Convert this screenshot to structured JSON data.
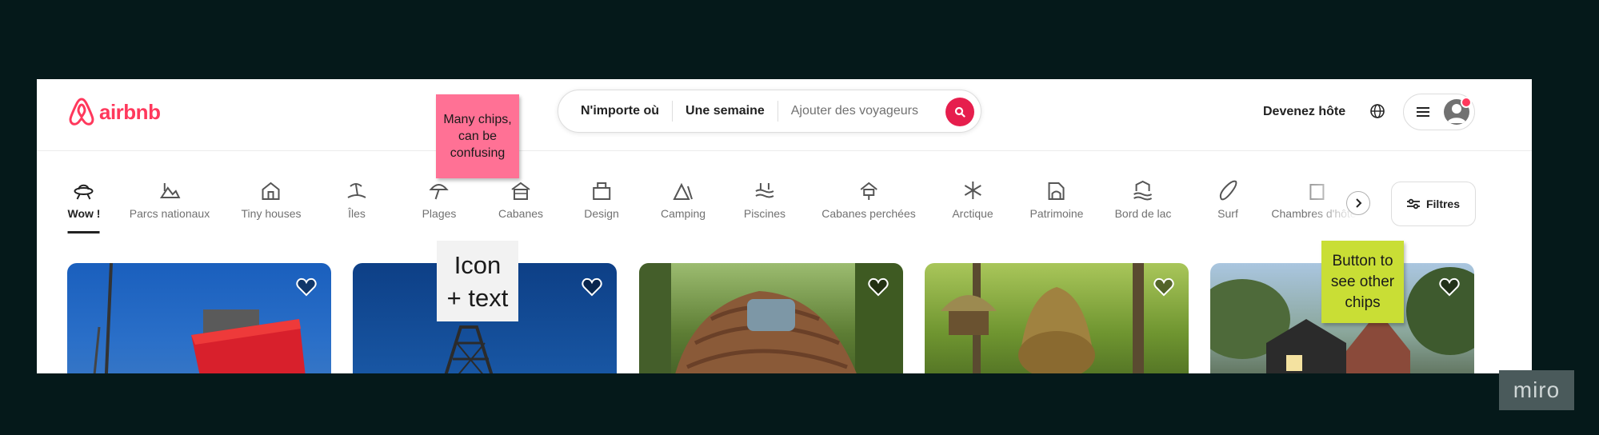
{
  "header": {
    "logo_text": "airbnb",
    "search": {
      "where": "N'importe où",
      "when": "Une semaine",
      "who_placeholder": "Ajouter des voyageurs"
    },
    "host_link": "Devenez hôte"
  },
  "categories": [
    {
      "label": "Wow !",
      "icon": "ufo-icon",
      "active": true
    },
    {
      "label": "Parcs nationaux",
      "icon": "park-icon"
    },
    {
      "label": "Tiny houses",
      "icon": "tiny-house-icon"
    },
    {
      "label": "Îles",
      "icon": "island-icon"
    },
    {
      "label": "Plages",
      "icon": "beach-umbrella-icon"
    },
    {
      "label": "Cabanes",
      "icon": "cabin-icon"
    },
    {
      "label": "Design",
      "icon": "design-icon"
    },
    {
      "label": "Camping",
      "icon": "camping-icon"
    },
    {
      "label": "Piscines",
      "icon": "pool-icon"
    },
    {
      "label": "Cabanes perchées",
      "icon": "treehouse-icon"
    },
    {
      "label": "Arctique",
      "icon": "snowflake-icon"
    },
    {
      "label": "Patrimoine",
      "icon": "heritage-icon"
    },
    {
      "label": "Bord de lac",
      "icon": "lake-icon"
    },
    {
      "label": "Surf",
      "icon": "surfboard-icon"
    },
    {
      "label": "Chambres d'hôtes",
      "icon": "room-icon"
    }
  ],
  "filters_label": "Filtres",
  "listings": [
    {
      "theme": "red-cabin-blue-sky",
      "color": "#1e5fb0"
    },
    {
      "theme": "tower-blue-sky",
      "color": "#1a4f9c"
    },
    {
      "theme": "shingle-dome-forest",
      "color": "#5a7a3a"
    },
    {
      "theme": "treehouse-forest",
      "color": "#6f8f2e"
    },
    {
      "theme": "dark-cabin-trees",
      "color": "#7a8a80"
    }
  ],
  "notes": {
    "chips": "Many chips,\ncan be\nconfusing",
    "icon_text": "Icon\n+ text",
    "button": "Button to\nsee other\nchips"
  },
  "watermark": "miro",
  "colors": {
    "brand": "#ff385c",
    "background": "#05191a"
  }
}
